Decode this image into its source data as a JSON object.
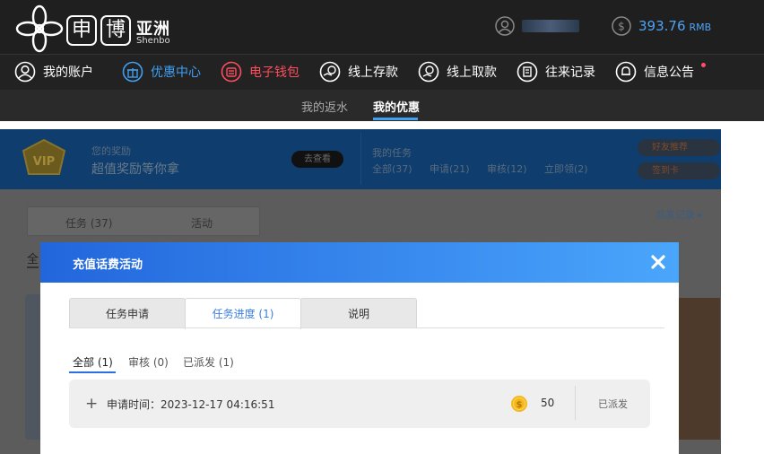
{
  "header": {
    "brand_box1": "申",
    "brand_box2": "博",
    "brand_cn": "亚洲",
    "brand_en": "Shenbo",
    "balance": "393.76",
    "balance_unit": "RMB"
  },
  "nav": {
    "items": [
      {
        "label": "我的账户",
        "icon": "user-icon"
      },
      {
        "label": "优惠中心",
        "icon": "gift-icon"
      },
      {
        "label": "电子钱包",
        "icon": "wallet-icon"
      },
      {
        "label": "线上存款",
        "icon": "deposit-icon"
      },
      {
        "label": "线上取款",
        "icon": "withdraw-icon"
      },
      {
        "label": "往来记录",
        "icon": "records-icon"
      },
      {
        "label": "信息公告",
        "icon": "bell-icon"
      }
    ]
  },
  "subnav": {
    "rebate": "我的返水",
    "promo": "我的优惠"
  },
  "background": {
    "reward_label": "您的奖励",
    "reward_title": "超值奖励等你拿",
    "view_btn": "去查看",
    "task_label": "我的任务",
    "task_all": "全部(37)",
    "task_apply": "申请(21)",
    "task_review": "审核(12)",
    "task_claim": "立即领(2)",
    "side1": "好友推荐",
    "side2": "签到卡",
    "tab_tasks": "任务 (37)",
    "tab_events": "活动",
    "dispatch_link": "派发记录 ▸",
    "all_tab": "全"
  },
  "modal": {
    "title": "充值话费活动",
    "tabs": [
      "任务申请",
      "任务进度 (1)",
      "说明"
    ],
    "filters": [
      "全部 (1)",
      "审核 (0)",
      "已派发 (1)"
    ],
    "record": {
      "time": "申请时间：2023-12-17 04:16:51",
      "amount": "50",
      "status": "已派发"
    }
  },
  "colors": {
    "accent": "#3fa0f4",
    "header_bg": "#1f1f1f",
    "modal_gradient_start": "#2266dc",
    "modal_gradient_end": "#4aa6fb",
    "wallet_red": "#ff4d5e"
  }
}
